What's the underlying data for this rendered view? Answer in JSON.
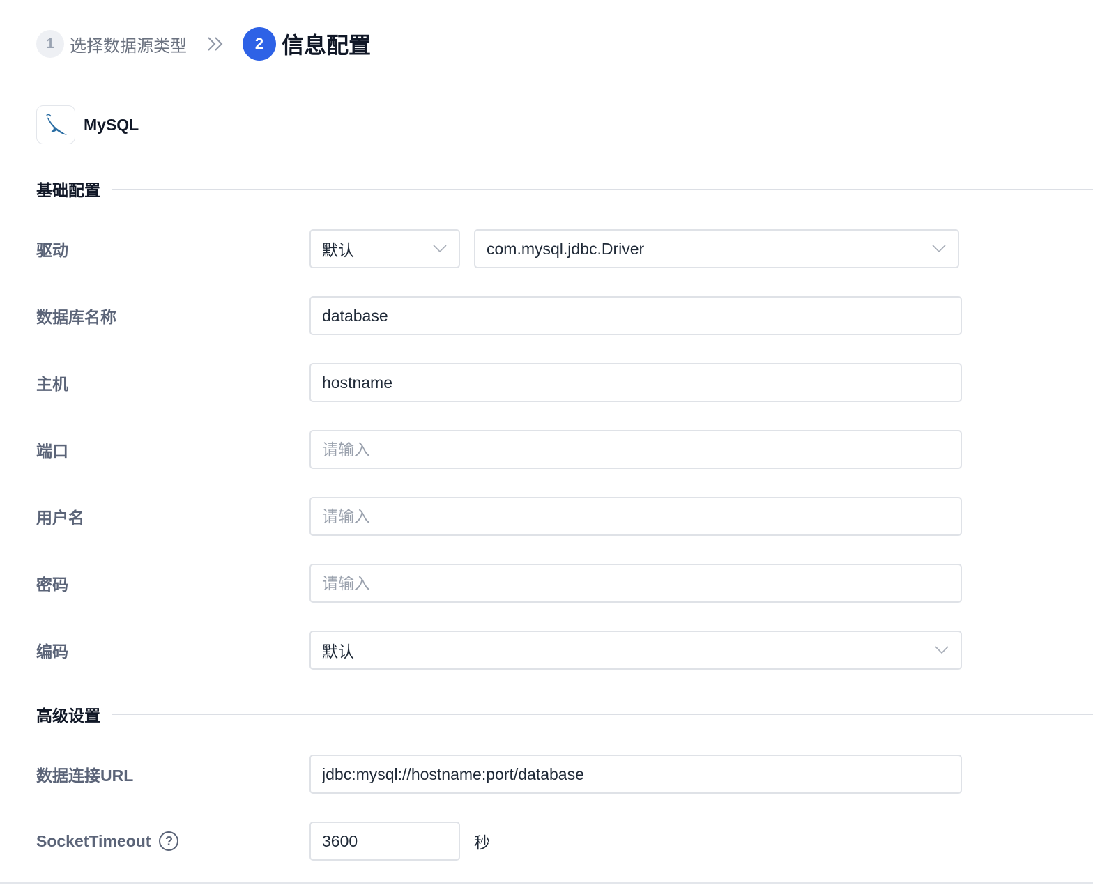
{
  "steps": [
    {
      "num": "1",
      "label": "选择数据源类型",
      "state": "done"
    },
    {
      "num": "2",
      "label": "信息配置",
      "state": "active"
    }
  ],
  "datasource": {
    "name": "MySQL",
    "icon": "mysql-dolphin-icon"
  },
  "sections": {
    "basic": "基础配置",
    "advanced": "高级设置"
  },
  "form": {
    "driver": {
      "label": "驱动",
      "mode": "默认",
      "class": "com.mysql.jdbc.Driver"
    },
    "database": {
      "label": "数据库名称",
      "value": "database"
    },
    "host": {
      "label": "主机",
      "value": "hostname"
    },
    "port": {
      "label": "端口",
      "placeholder": "请输入"
    },
    "username": {
      "label": "用户名",
      "placeholder": "请输入"
    },
    "password": {
      "label": "密码",
      "placeholder": "请输入"
    },
    "encoding": {
      "label": "编码",
      "value": "默认"
    },
    "url": {
      "label": "数据连接URL",
      "value": "jdbc:mysql://hostname:port/database"
    },
    "socket_timeout": {
      "label": "SocketTimeout",
      "value": "3600",
      "unit": "秒",
      "help": "?"
    }
  },
  "colors": {
    "accent": "#2e62e6",
    "label": "#5b6478",
    "border": "#dfe2e7"
  }
}
